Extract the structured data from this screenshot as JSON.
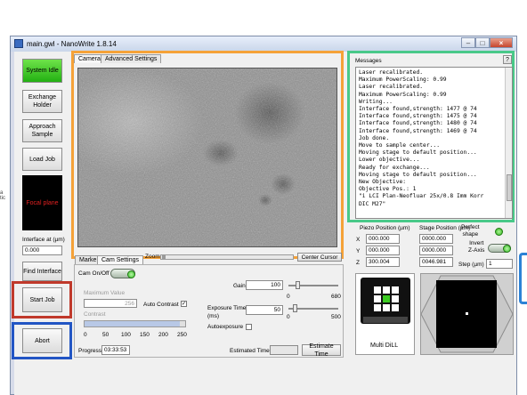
{
  "window": {
    "title": "main.gwl - NanoWrite 1.8.14",
    "min": "–",
    "max": "□",
    "close": "×"
  },
  "sidebar": {
    "system_idle": "System Idle",
    "exchange_holder": "Exchange Holder",
    "approach_sample": "Approach Sample",
    "load_job": "Load Job",
    "focal_plane": "Focal plane",
    "interface_label": "Interface at (µm)",
    "interface_value": "0.000",
    "find_interface": "Find Interface",
    "start_job": "Start Job",
    "abort": "Abort"
  },
  "camera_tabs": {
    "camera": "Camera",
    "advanced": "Advanced Settings"
  },
  "lower_tabs": {
    "marker": "Marker",
    "cam_settings": "Cam Settings"
  },
  "zoom": {
    "label": "Zoom",
    "center_cursor": "Center Cursor"
  },
  "cam_settings": {
    "cam_onoff": "Cam On/Off",
    "max_value_label": "Maximum Value",
    "max_value": "256",
    "auto_contrast": "Auto Contrast",
    "auto_contrast_checked": "✓",
    "contrast_label": "Contrast",
    "contrast_ticks": [
      "0",
      "50",
      "100",
      "150",
      "200",
      "250"
    ],
    "contrast_level_pct": 95,
    "gain_label": "Gain",
    "gain_value": "100",
    "gain_ticks": [
      "0",
      "680"
    ],
    "gain_level_pct": 15,
    "exposure_label": "Exposure Time\n(ms)",
    "exposure_value": "50",
    "exposure_ticks": [
      "0",
      "500"
    ],
    "exposure_level_pct": 10,
    "autoexposure": "Autoexposure"
  },
  "progress": {
    "label": "Progress",
    "value": "03:33:53"
  },
  "estimate": {
    "label": "Estimated Time",
    "value": "",
    "button": "Estimate Time"
  },
  "messages": {
    "title": "Messages",
    "help": "?",
    "lines": [
      "Laser recalibrated.",
      "Maximum PowerScaling: 0.99",
      "Laser recalibrated.",
      "Maximum PowerScaling: 0.99",
      "Writing...",
      "Interface found,strength: 1477 @ 74",
      "Interface found,strength: 1475 @ 74",
      "Interface found,strength: 1480 @ 74",
      "Interface found,strength: 1469 @ 74",
      "Job done.",
      "Move to sample center...",
      "Moving stage to default position...",
      "Lower objective...",
      "Ready for exchange...",
      "Moving stage to default position...",
      "New Objective:",
      "Objective Pos.: 1",
      "\"i LCI Plan-Neofluar 25x/0.8 Imm Korr",
      "DIC M27\""
    ]
  },
  "position": {
    "piezo_label": "Piezo Position (µm)",
    "stage_label": "Stage Position (µm)",
    "axes": [
      "X",
      "Y",
      "Z"
    ],
    "piezo": [
      "000.000",
      "000.000",
      "300.004"
    ],
    "stage": [
      "0000.000",
      "0000.000",
      "0046.981"
    ],
    "perfect_shape": "Perfect\nshape",
    "invert_z": "Invert\nZ-Axis",
    "step_label": "Step (µm)",
    "step_value": "1"
  },
  "objective": {
    "label": "Multi DiLL"
  },
  "colors": {
    "orange": "#f5a238",
    "green": "#49c989",
    "red": "#c0392b",
    "blue": "#2255c4",
    "idle_green": "#3ccc22"
  }
}
